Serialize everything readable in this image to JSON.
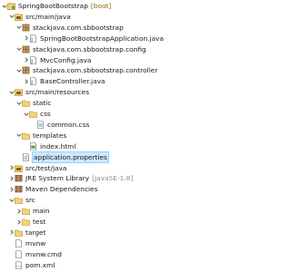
{
  "tree": {
    "items": [
      {
        "label": "SpringBootBootstrap",
        "decoration": "[boot]",
        "icon": "project-icon",
        "expanded": true
      },
      {
        "label": "src/main/java",
        "icon": "source-folder-icon",
        "expanded": true
      },
      {
        "label": "stackjava.com.sbbootstrap",
        "icon": "package-icon",
        "expanded": true
      },
      {
        "label": "SpringBootBootstrapApplication.java",
        "icon": "java-file-icon",
        "expanded": false
      },
      {
        "label": "stackjava.com.sbbootstrap.config",
        "icon": "package-icon",
        "expanded": true
      },
      {
        "label": "MvcConfig.java",
        "icon": "java-file-icon",
        "expanded": false
      },
      {
        "label": "stackjava.com.sbbootstrap.controller",
        "icon": "package-icon",
        "expanded": true
      },
      {
        "label": "BaseController.java",
        "icon": "java-file-icon",
        "expanded": false
      },
      {
        "label": "src/main/resources",
        "icon": "source-folder-icon",
        "expanded": true
      },
      {
        "label": "static",
        "icon": "folder-icon",
        "expanded": true
      },
      {
        "label": "css",
        "icon": "folder-icon",
        "expanded": true
      },
      {
        "label": "common.css",
        "icon": "css-file-icon"
      },
      {
        "label": "templates",
        "icon": "folder-icon",
        "expanded": true
      },
      {
        "label": "index.html",
        "icon": "html-file-icon"
      },
      {
        "label": "application.properties",
        "icon": "properties-file-icon",
        "selected": true
      },
      {
        "label": "src/test/java",
        "icon": "source-folder-icon",
        "expanded": false
      },
      {
        "label": "JRE System Library",
        "decoration": "[JavaSE-1.8]",
        "icon": "library-icon",
        "expanded": false
      },
      {
        "label": "Maven Dependencies",
        "icon": "library-icon",
        "expanded": false
      },
      {
        "label": "src",
        "icon": "folder-icon",
        "expanded": true
      },
      {
        "label": "main",
        "icon": "folder-icon",
        "expanded": false
      },
      {
        "label": "test",
        "icon": "folder-icon",
        "expanded": false
      },
      {
        "label": "target",
        "icon": "folder-icon",
        "expanded": false
      },
      {
        "label": "mvnw",
        "icon": "file-icon"
      },
      {
        "label": "mvnw.cmd",
        "icon": "file-icon"
      },
      {
        "label": "pom.xml",
        "icon": "xml-file-icon"
      }
    ]
  }
}
